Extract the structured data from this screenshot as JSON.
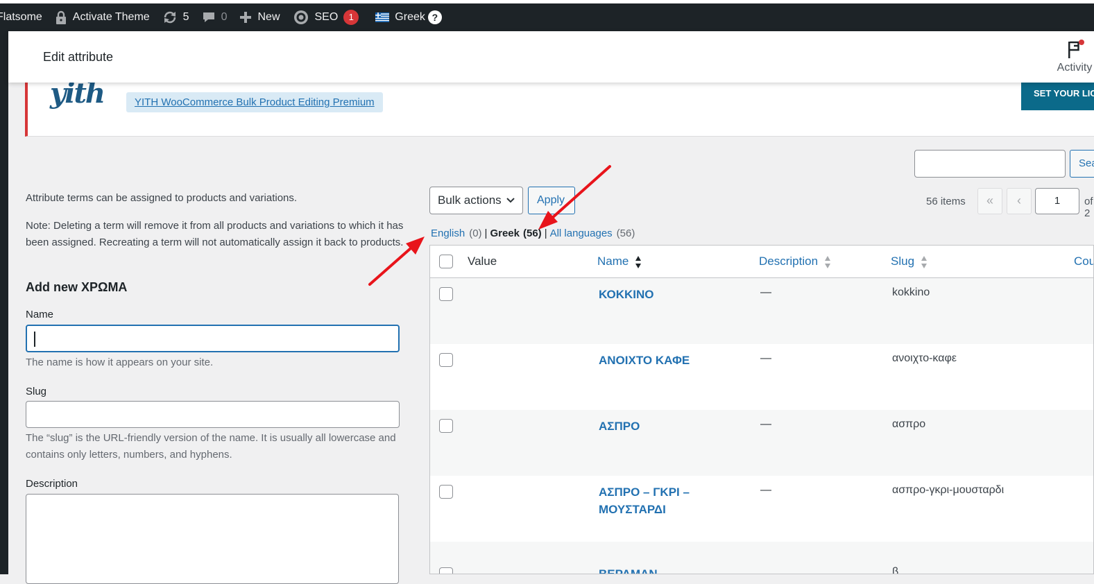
{
  "admin_bar": {
    "site_name": "Flatsome",
    "activate_theme": "Activate Theme",
    "updates_count": "5",
    "comments_count": "0",
    "new_label": "New",
    "seo_label": "SEO",
    "seo_badge": "1",
    "language_label": "Greek",
    "help_mark": "?",
    "icons": [
      "lock-icon",
      "refresh-icon",
      "comment-icon",
      "plus-icon",
      "seo-gear-icon",
      "greek-flag-icon",
      "help-icon"
    ]
  },
  "header": {
    "title": "Edit attribute",
    "activity_label": "Activity"
  },
  "notice": {
    "logo_text": "yith",
    "link_text": "YITH WooCommerce Bulk Product Editing Premium",
    "button_label": "SET YOUR LICENSE KEY"
  },
  "search": {
    "button_label": "Search Attributes",
    "value": ""
  },
  "form": {
    "intro": "Attribute terms can be assigned to products and variations.",
    "note": "Note: Deleting a term will remove it from all products and variations to which it has been assigned. Recreating a term will not automatically assign it back to products.",
    "heading": "Add new ΧΡΩΜΑ",
    "name_label": "Name",
    "name_value": "",
    "name_help": "The name is how it appears on your site.",
    "slug_label": "Slug",
    "slug_value": "",
    "slug_help": "The “slug” is the URL-friendly version of the name. It is usually all lowercase and contains only letters, numbers, and hyphens.",
    "description_label": "Description",
    "description_value": ""
  },
  "table_nav": {
    "bulk_actions": "Bulk actions",
    "apply": "Apply",
    "items_count": "56 items",
    "first_page": "«",
    "prev_page": "‹",
    "current_page": "1",
    "of_label": "of 2"
  },
  "language_filter": {
    "english": "English",
    "english_count": "(0)",
    "greek": "Greek",
    "greek_count": "(56)",
    "all": "All languages",
    "all_count": "(56)",
    "separator": "|"
  },
  "table": {
    "columns": {
      "value": "Value",
      "name": "Name",
      "description": "Description",
      "slug": "Slug",
      "count": "Count"
    },
    "rows": [
      {
        "name": "ΚΟΚΚΙΝΟ",
        "description": "—",
        "slug": "kokkino"
      },
      {
        "name": "ΑΝΟΙΧΤΟ ΚΑΦΕ",
        "description": "—",
        "slug": "ανοιχτο-καφε"
      },
      {
        "name": "ΑΣΠΡΟ",
        "description": "—",
        "slug": "ασπρο"
      },
      {
        "name": "ΑΣΠΡΟ – ΓΚΡΙ – ΜΟΥΣΤΑΡΔΙ",
        "description": "—",
        "slug": "ασπρο-γκρι-μουσταρδι"
      },
      {
        "name": "ΒΕΡΑΜΑΝ",
        "description": "",
        "slug": "β"
      }
    ]
  },
  "colors": {
    "admin_bar": "#1d2327",
    "link": "#2271b1",
    "notice_border": "#d63638",
    "license_button": "#0b6a8a",
    "annotation_arrow": "#e8141b"
  }
}
